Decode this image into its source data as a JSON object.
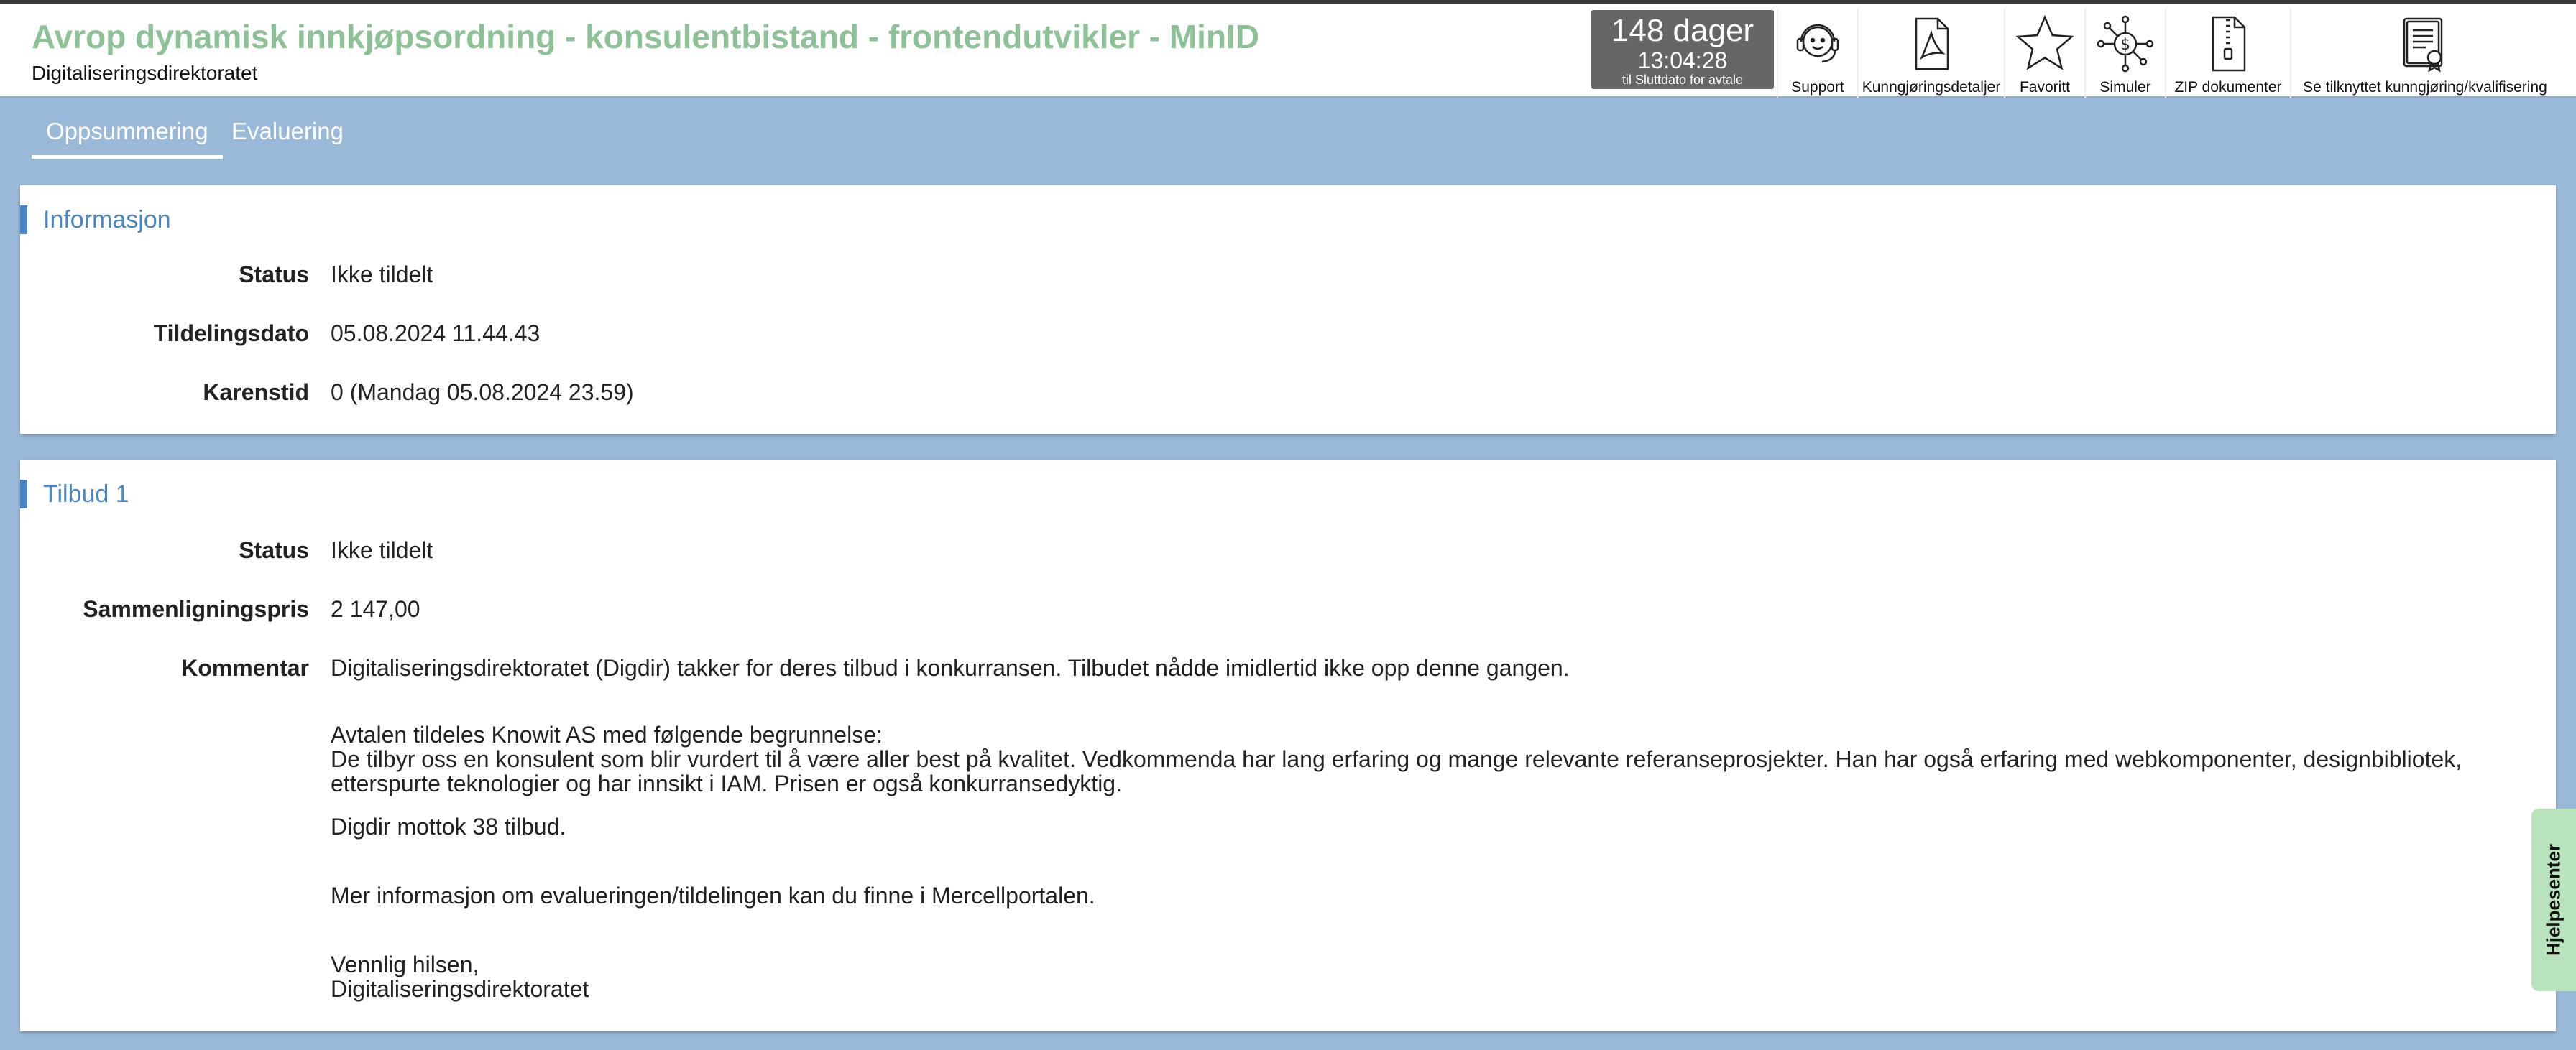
{
  "header": {
    "title": "Avrop dynamisk innkjøpsordning - konsulentbistand - frontendutvikler - MinID",
    "organization": "Digitaliseringsdirektoratet",
    "countdown": {
      "days": "148 dager",
      "time": "13:04:28",
      "until": "til Sluttdato for avtale"
    },
    "toolbar": [
      {
        "label": "Support",
        "icon": "headset-icon"
      },
      {
        "label": "Kunngjøringsdetaljer",
        "icon": "pdf-icon"
      },
      {
        "label": "Favoritt",
        "icon": "star-icon"
      },
      {
        "label": "Simuler",
        "icon": "simulate-icon"
      },
      {
        "label": "ZIP dokumenter",
        "icon": "zip-icon"
      },
      {
        "label": "Se tilknyttet kunngjøring/kvalifisering",
        "icon": "document-certificate-icon"
      }
    ]
  },
  "tabs": [
    {
      "label": "Oppsummering",
      "active": true
    },
    {
      "label": "Evaluering",
      "active": false
    }
  ],
  "informasjon": {
    "title": "Informasjon",
    "rows": [
      {
        "label": "Status",
        "value": "Ikke tildelt"
      },
      {
        "label": "Tildelingsdato",
        "value": "05.08.2024 11.44.43"
      },
      {
        "label": "Karenstid",
        "value": "0 (Mandag 05.08.2024 23.59)"
      }
    ]
  },
  "tilbud": {
    "title": "Tilbud 1",
    "rows": [
      {
        "label": "Status",
        "value": "Ikke tildelt"
      },
      {
        "label": "Sammenligningspris",
        "value": "2 147,00"
      }
    ],
    "comment_label": "Kommentar",
    "comment_intro": "Digitaliseringsdirektoratet (Digdir) takker for deres tilbud i konkurransen. Tilbudet nådde imidlertid ikke opp denne gangen.",
    "comment_award_1": "Avtalen tildeles Knowit AS med følgende begrunnelse:",
    "comment_award_2": "De tilbyr oss en konsulent som blir vurdert til å være aller best på kvalitet. Vedkommenda har lang erfaring og mange relevante referanseprosjekter. Han har også erfaring med webkomponenter, designbibliotek,",
    "comment_award_3": "etterspurte teknologier og har innsikt i IAM. Prisen er også konkurransedyktig.",
    "comment_count": "Digdir mottok 38 tilbud.",
    "comment_more": "Mer informasjon om evalueringen/tildelingen kan du finne i Mercellportalen.",
    "comment_closing_1": "Vennlig hilsen,",
    "comment_closing_2": "Digitaliseringsdirektoratet"
  },
  "help_tab": "Hjelpesenter"
}
